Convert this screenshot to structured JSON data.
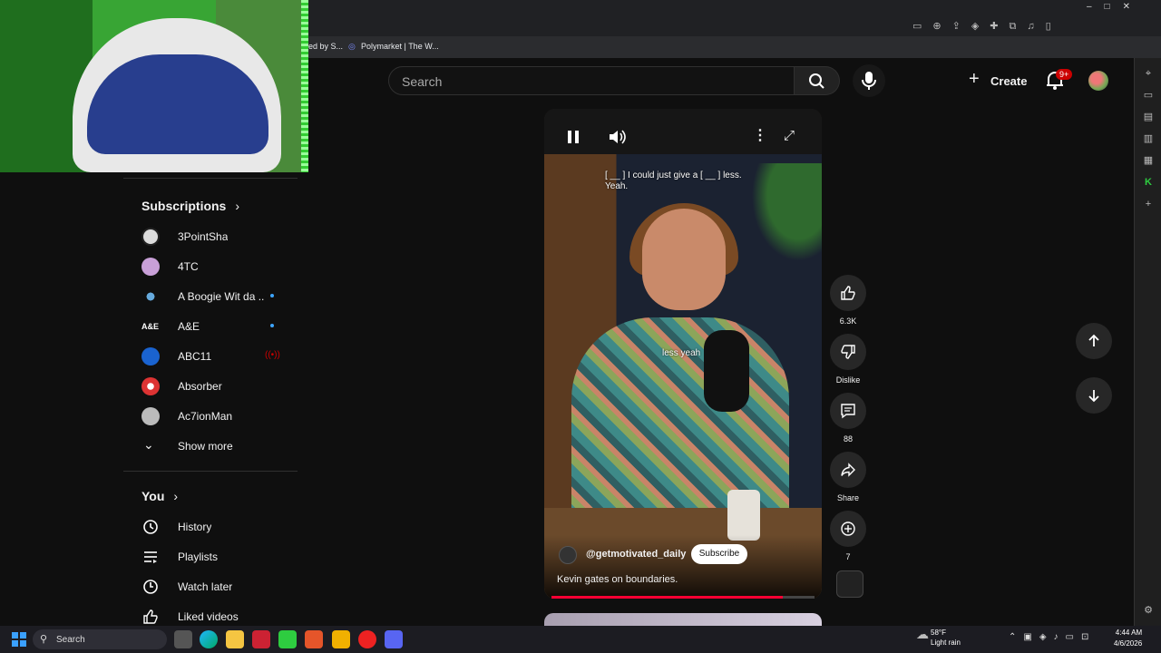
{
  "bookmarks": [
    "ed by S...",
    "Polymarket | The W..."
  ],
  "search": {
    "placeholder": "Search"
  },
  "header": {
    "create_label": "Create",
    "notifications_badge": "9+"
  },
  "sidebar": {
    "subscriptions_heading": "Subscriptions",
    "subscriptions": [
      {
        "label": "3PointSha",
        "indicator": ""
      },
      {
        "label": "4TC",
        "indicator": ""
      },
      {
        "label": "A Boogie Wit da ...",
        "indicator": "new"
      },
      {
        "label": "A&E",
        "indicator": "new"
      },
      {
        "label": "ABC11",
        "indicator": "live"
      },
      {
        "label": "Absorber",
        "indicator": ""
      },
      {
        "label": "Ac7ionMan",
        "indicator": ""
      }
    ],
    "show_more_label": "Show more",
    "you_heading": "You",
    "you_items": [
      {
        "label": "History",
        "icon": "history-icon"
      },
      {
        "label": "Playlists",
        "icon": "playlists-icon"
      },
      {
        "label": "Watch later",
        "icon": "clock-icon"
      },
      {
        "label": "Liked videos",
        "icon": "thumbs-up-icon"
      }
    ]
  },
  "video": {
    "caption_top_line1": "[ __ ] I could just give a [ __ ] less.",
    "caption_top_line2": "Yeah.",
    "caption_mid": "less yeah",
    "channel_handle": "@getmotivated_daily",
    "subscribe_label": "Subscribe",
    "title": "Kevin gates on boundaries.",
    "progress_fraction": 0.88
  },
  "actions": {
    "likes": "6.3K",
    "dislike_label": "Dislike",
    "comments": "88",
    "share_label": "Share",
    "remix_count": "7"
  },
  "taskbar": {
    "search_label": "Search",
    "weather_temp": "58°F",
    "weather_desc": "Light rain",
    "time": "4:44 AM",
    "date": "4/6/2026"
  },
  "colors": {
    "accent_red": "#ff0033",
    "background": "#0f0f0f",
    "button_bg": "#272727",
    "webcam_green": "#2d8a2a"
  }
}
